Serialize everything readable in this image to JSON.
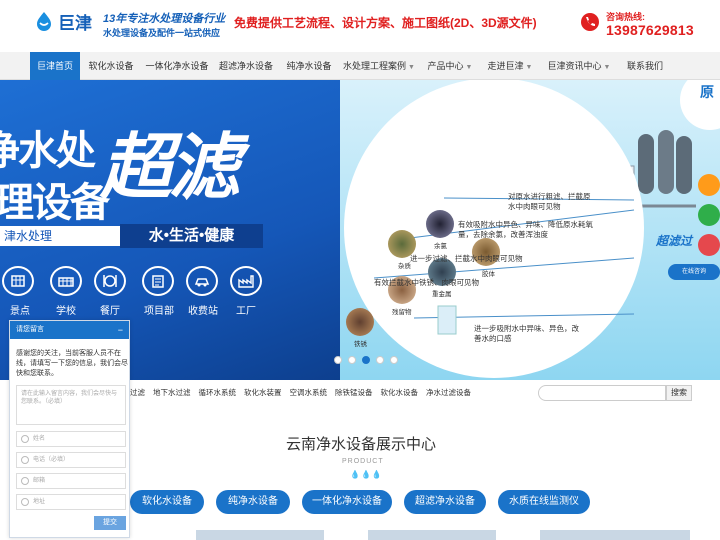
{
  "header": {
    "logo_text": "巨津",
    "slogan_line1": "13年专注水处理设备行业",
    "slogan_line2": "水处理设备及配件一站式供应",
    "promo": "免费提供工艺流程、设计方案、施工图纸(2D、3D源文件)",
    "hotline_label": "咨询热线:",
    "hotline_number": "13987629813"
  },
  "nav": {
    "items": [
      "巨津首页",
      "软化水设备",
      "一体化净水设备",
      "超滤净水设备",
      "纯净水设备",
      "水处理工程案例",
      "产品中心",
      "走进巨津",
      "巨津资讯中心",
      "联系我们"
    ],
    "active_index": 0
  },
  "banner": {
    "big_left_1": "净水处",
    "big_left_2": "理设备",
    "big_main": "超滤",
    "sub_left": "津水处理",
    "sub_right": "水•生活•健康",
    "icons": [
      {
        "name": "scenic-icon",
        "label": "景点"
      },
      {
        "name": "school-icon",
        "label": "学校"
      },
      {
        "name": "restaurant-icon",
        "label": "餐厅"
      },
      {
        "name": "project-icon",
        "label": "项目部"
      },
      {
        "name": "toll-icon",
        "label": "收费站"
      },
      {
        "name": "factory-icon",
        "label": "工厂"
      }
    ],
    "bacteria": [
      "杂质",
      "余氯",
      "胶体",
      "重金属",
      "残留物",
      "铁锈"
    ],
    "desc": [
      "对原水进行粗滤、拦截原水中肉眼可见物",
      "有效吸附水中异色、异味、降低原水耗氧量，去除余氯，改善浑浊度",
      "进一步过滤、拦截水中肉眼可见物",
      "有效拦截水中铁锈、肉眼可见物",
      "进一步吸附水中异味、异色，改善水的口感"
    ],
    "right_tag": "超滤过",
    "right_top": "原",
    "slide_count": 5,
    "slide_active": 2
  },
  "tags": [
    "过滤",
    "地下水过滤",
    "循环水系统",
    "软化水装置",
    "空调水系统",
    "除铁锰设备",
    "软化水设备",
    "净水过滤设备"
  ],
  "search": {
    "placeholder": "",
    "button": "搜索"
  },
  "section": {
    "title": "云南净水设备展示中心",
    "subtitle": "PRODUCT",
    "categories": [
      "软化水设备",
      "纯净水设备",
      "一体化净水设备",
      "超滤净水设备",
      "水质在线监测仪"
    ]
  },
  "chat": {
    "title": "请您留言",
    "minimize": "−",
    "message": "感谢您的关注，当前客服人员不在线，请填写一下您的信息，我们会尽快和您联系。",
    "textarea_placeholder": "请在此输入留言内容，我们会尽快与您联系。（必填）",
    "fields": [
      "姓名",
      "电话（必填）",
      "邮箱",
      "地址"
    ],
    "send": "提交"
  },
  "float_badge": "在线咨询",
  "colors": {
    "brand_blue": "#1a73c9",
    "accent_red": "#e02020"
  }
}
